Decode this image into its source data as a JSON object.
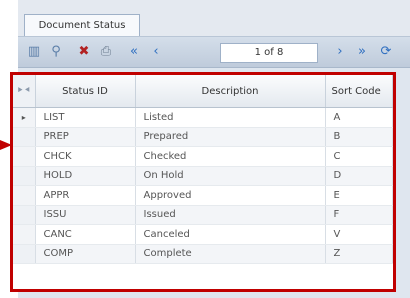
{
  "tab": {
    "title": "Document Status"
  },
  "toolbar": {
    "page_indicator": "1 of 8"
  },
  "grid": {
    "columns": [
      "Status ID",
      "Description",
      "Sort Code"
    ],
    "rows": [
      {
        "selected": true,
        "id": "LIST",
        "description": "Listed",
        "sort": "A"
      },
      {
        "id": "PREP",
        "description": "Prepared",
        "sort": "B"
      },
      {
        "id": "CHCK",
        "description": "Checked",
        "sort": "C"
      },
      {
        "id": "HOLD",
        "description": "On Hold",
        "sort": "D"
      },
      {
        "id": "APPR",
        "description": "Approved",
        "sort": "E"
      },
      {
        "id": "ISSU",
        "description": "Issued",
        "sort": "F"
      },
      {
        "id": "CANC",
        "description": "Canceled",
        "sort": "V"
      },
      {
        "id": "COMP",
        "description": "Complete",
        "sort": "Z"
      }
    ]
  },
  "colors": {
    "highlight_border": "#c00000",
    "toolbar_blue": "#2f6fc0"
  },
  "icons": [
    "columns-icon",
    "filter-icon",
    "delete-icon",
    "print-icon",
    "first-page-icon",
    "previous-page-icon",
    "next-page-icon",
    "last-page-icon",
    "refresh-icon"
  ]
}
